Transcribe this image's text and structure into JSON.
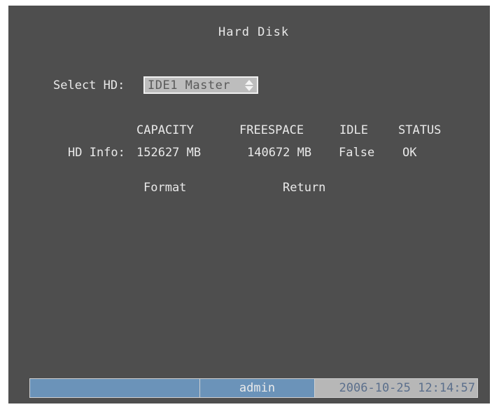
{
  "title": "Hard Disk",
  "select_hd": {
    "label": "Select HD:",
    "value": "IDE1 Master"
  },
  "table": {
    "columns": [
      "CAPACITY",
      "FREESPACE",
      "IDLE",
      "STATUS"
    ],
    "row_label": "HD Info:",
    "values": [
      "152627 MB",
      "140672 MB",
      "False",
      "OK"
    ]
  },
  "buttons": {
    "format": "Format",
    "return": "Return"
  },
  "statusbar": {
    "user": "admin",
    "datetime": "2006-10-25 12:14:57"
  }
}
